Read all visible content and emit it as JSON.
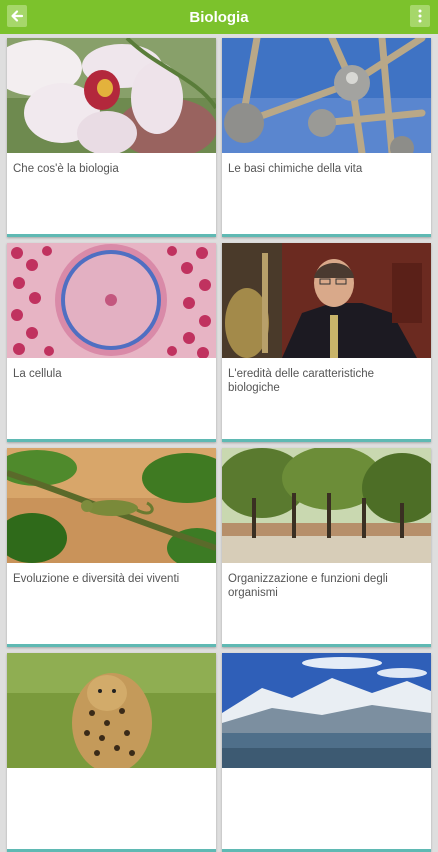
{
  "header": {
    "title": "Biologia",
    "back_icon": "arrow-left-icon",
    "menu_icon": "more-vertical-icon"
  },
  "colors": {
    "header": "#7cc22c",
    "card_accent": "#5fb9b3",
    "background": "#dedede"
  },
  "cards": [
    {
      "label": "Che cos'è la biologia",
      "image": "orchid-flower-photo"
    },
    {
      "label": "Le basi chimiche della vita",
      "image": "molecule-model-photo"
    },
    {
      "label": "La cellula",
      "image": "cell-microscope-photo"
    },
    {
      "label": "L'eredità delle caratteristiche biologiche",
      "image": "mendel-portrait-photo"
    },
    {
      "label": "Evoluzione e diversità dei viventi",
      "image": "chameleon-branch-photo"
    },
    {
      "label": "Organizzazione e funzioni degli organismi",
      "image": "forest-landscape-photo"
    },
    {
      "label": "",
      "image": "leopard-photo"
    },
    {
      "label": "",
      "image": "mountain-lake-photo"
    }
  ]
}
